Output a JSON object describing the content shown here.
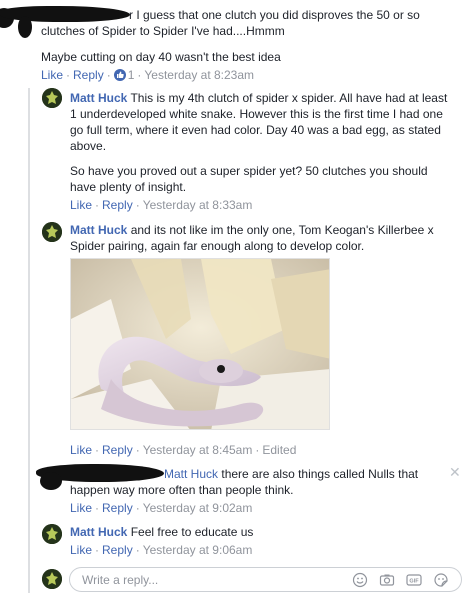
{
  "comments": [
    {
      "author": "",
      "text": "r I guess that one clutch you did disproves the 50 or so clutches of Spider to Spider I've had....Hmmm",
      "text2": "Maybe cutting on day 40 wasn't the best idea",
      "like": "Like",
      "reply": "Reply",
      "reaction_count": "1",
      "time": "Yesterday at 8:23am"
    },
    {
      "author": "Matt Huck",
      "text": "This is my 4th clutch of spider x spider. All have had at least 1 underdeveloped white snake. However this is the first time I had one go full term, where it even had color. Day 40 was a bad egg, as stated above.",
      "text2": "So have you proved out a super spider yet? 50 clutches you should have plenty of insight.",
      "like": "Like",
      "reply": "Reply",
      "time": "Yesterday at 8:33am"
    },
    {
      "author": "Matt Huck",
      "text": "and its not like im the only one, Tom Keogan's Killerbee x Spider pairing, again far enough along to develop color.",
      "like": "Like",
      "reply": "Reply",
      "time": "Yesterday at 8:45am",
      "edited": "Edited"
    },
    {
      "author": "",
      "tag": "Matt Huck",
      "text": "there are also things called Nulls that happen way more often than people think.",
      "like": "Like",
      "reply": "Reply",
      "time": "Yesterday at 9:02am"
    },
    {
      "author": "Matt Huck",
      "text": "Feel free to educate us",
      "like": "Like",
      "reply": "Reply",
      "time": "Yesterday at 9:06am"
    }
  ],
  "reply_box": {
    "placeholder": "Write a reply..."
  },
  "icons": {
    "emoji": "emoji-icon",
    "camera": "camera-icon",
    "gif": "gif-icon",
    "sticker": "sticker-icon",
    "close": "close-icon",
    "like_reaction": "like-reaction-icon"
  },
  "colors": {
    "name": "#365899",
    "link": "#4267b2",
    "meta": "#90949c",
    "text": "#1d2129"
  }
}
